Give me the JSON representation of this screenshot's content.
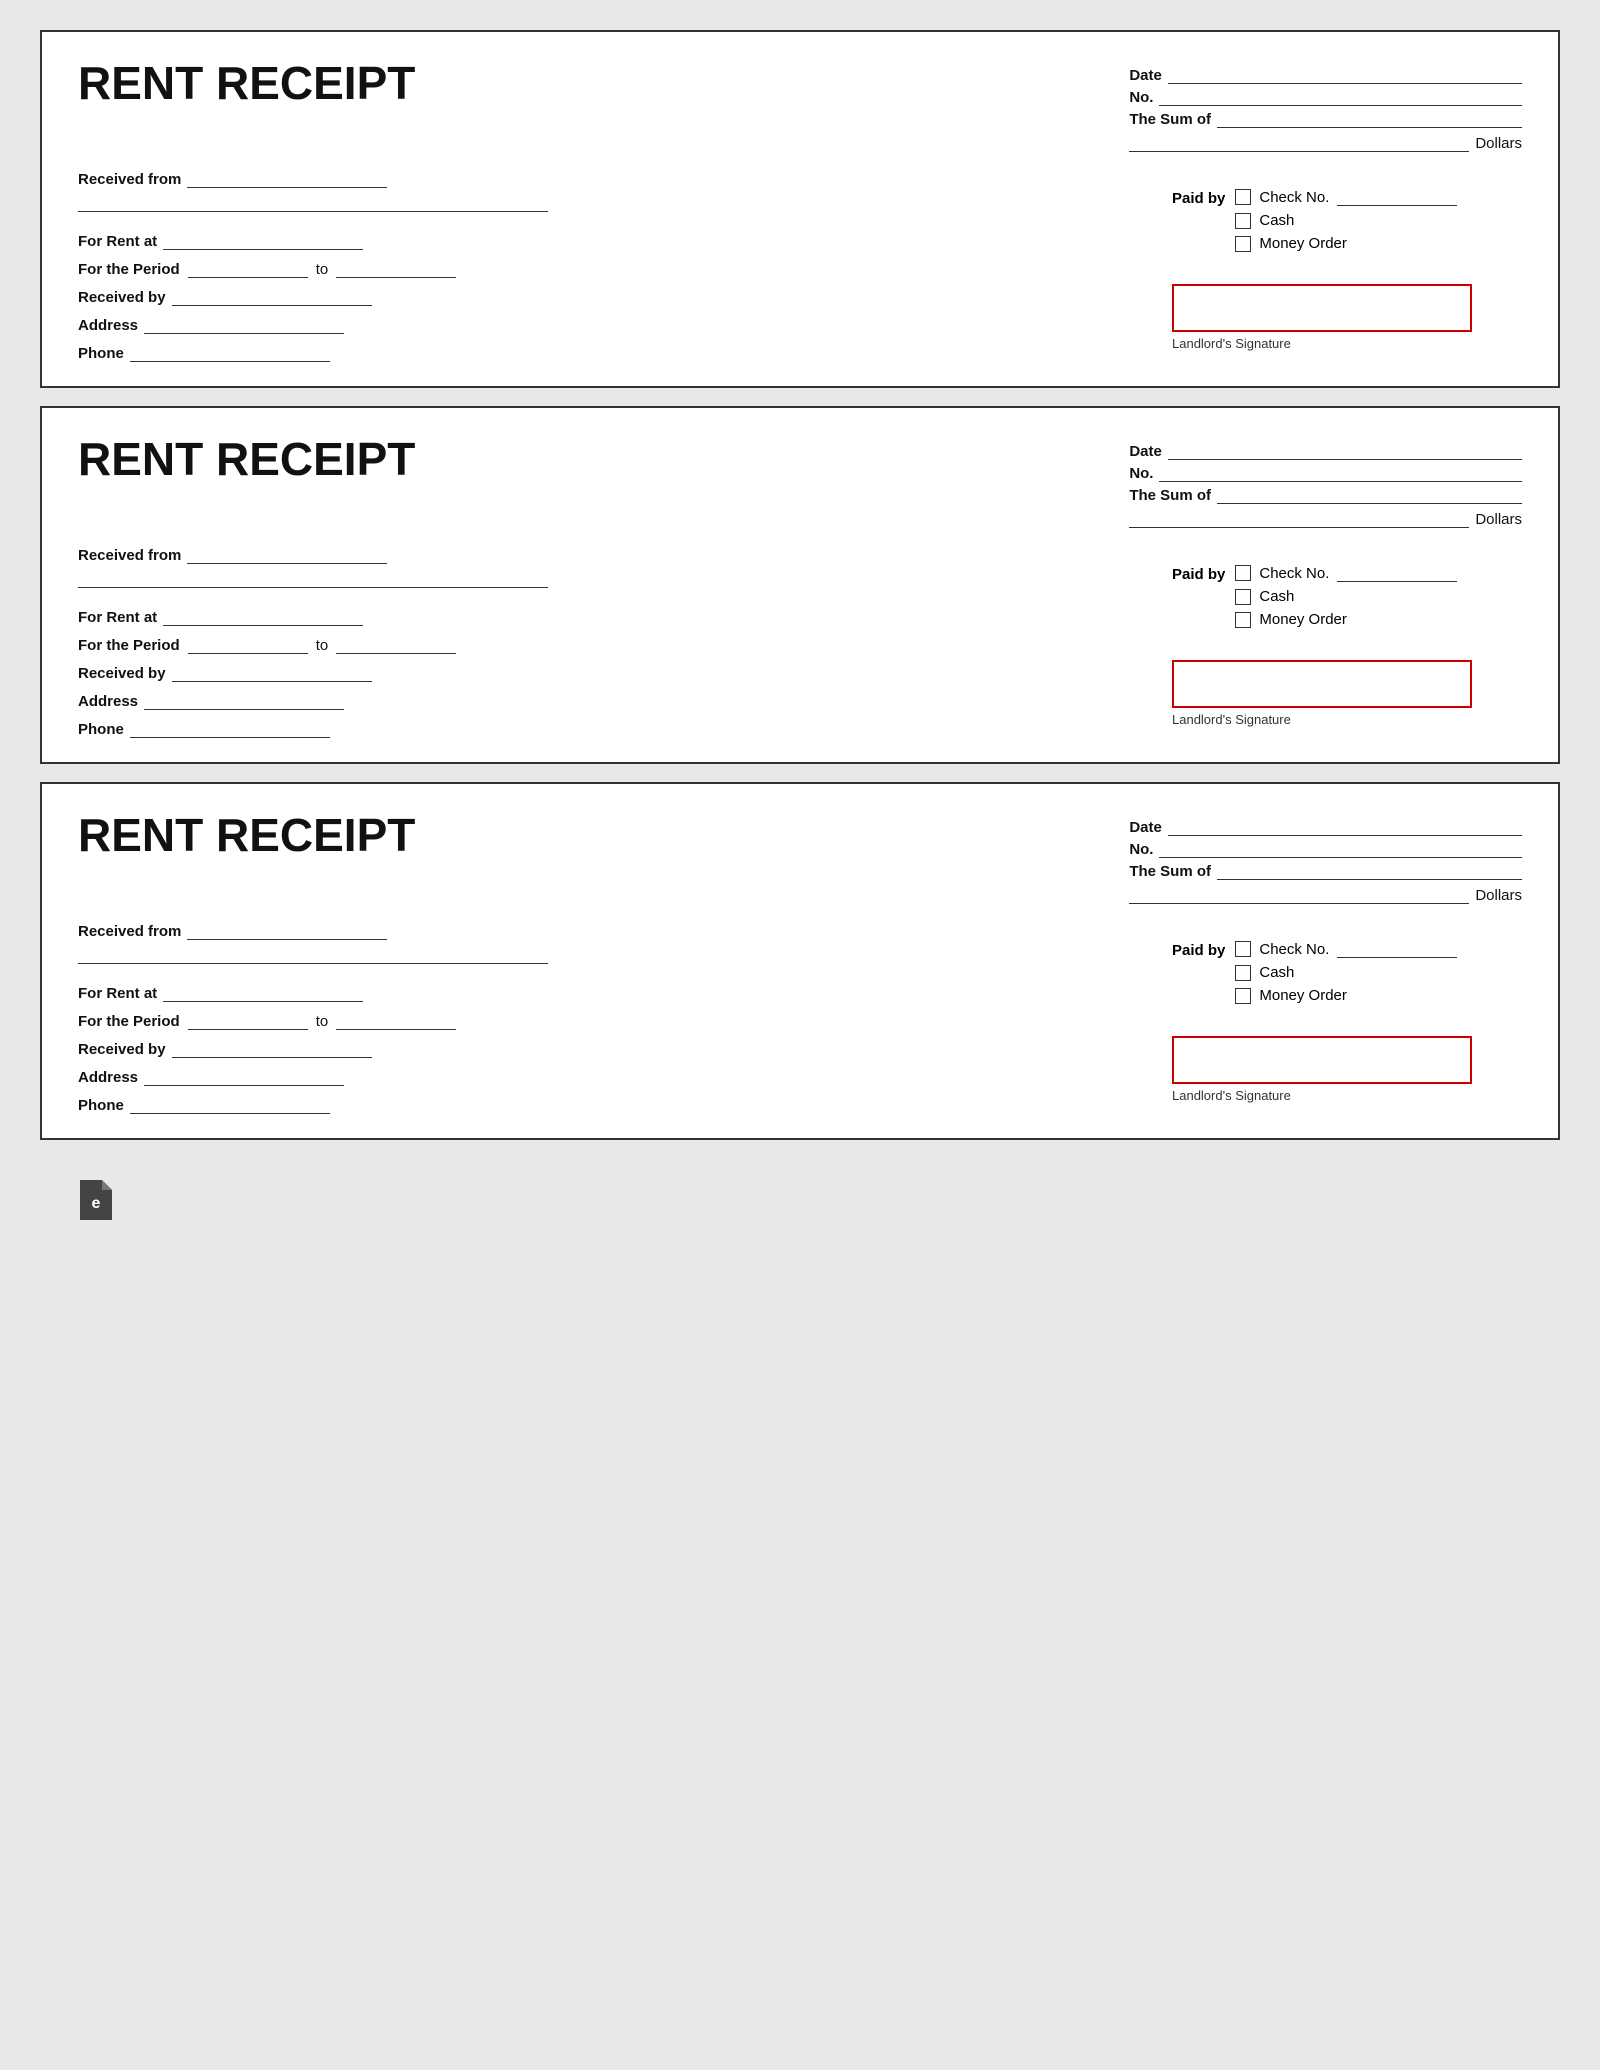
{
  "receipts": [
    {
      "title": "RENT RECEIPT",
      "date_label": "Date",
      "no_label": "No.",
      "sum_label": "The Sum of",
      "dollars_label": "Dollars",
      "received_from_label": "Received from",
      "for_rent_label": "For Rent at",
      "period_label": "For the Period",
      "to_label": "to",
      "received_by_label": "Received by",
      "address_label": "Address",
      "phone_label": "Phone",
      "paid_by_label": "Paid by",
      "check_no_label": "Check No.",
      "cash_label": "Cash",
      "money_order_label": "Money Order",
      "signature_label": "Landlord's Signature"
    },
    {
      "title": "RENT RECEIPT",
      "date_label": "Date",
      "no_label": "No.",
      "sum_label": "The Sum of",
      "dollars_label": "Dollars",
      "received_from_label": "Received from",
      "for_rent_label": "For Rent at",
      "period_label": "For the Period",
      "to_label": "to",
      "received_by_label": "Received by",
      "address_label": "Address",
      "phone_label": "Phone",
      "paid_by_label": "Paid by",
      "check_no_label": "Check No.",
      "cash_label": "Cash",
      "money_order_label": "Money Order",
      "signature_label": "Landlord's Signature"
    },
    {
      "title": "RENT RECEIPT",
      "date_label": "Date",
      "no_label": "No.",
      "sum_label": "The Sum of",
      "dollars_label": "Dollars",
      "received_from_label": "Received from",
      "for_rent_label": "For Rent at",
      "period_label": "For the Period",
      "to_label": "to",
      "received_by_label": "Received by",
      "address_label": "Address",
      "phone_label": "Phone",
      "paid_by_label": "Paid by",
      "check_no_label": "Check No.",
      "cash_label": "Cash",
      "money_order_label": "Money Order",
      "signature_label": "Landlord's Signature"
    }
  ],
  "footer": {
    "icon_label": "e"
  }
}
